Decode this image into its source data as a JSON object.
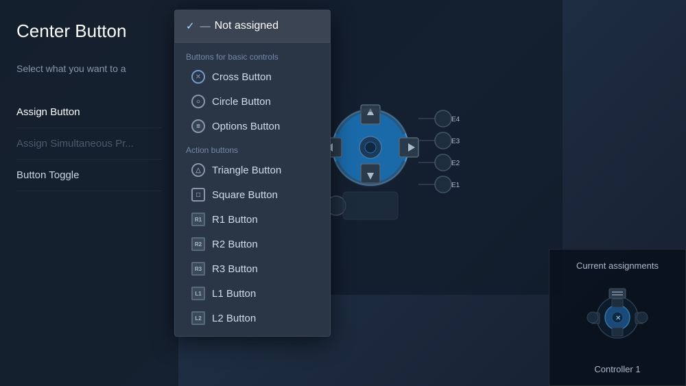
{
  "page": {
    "title": "Center Button",
    "select_hint": "Select what you want to a",
    "background_color": "#1a2535"
  },
  "menu": {
    "items": [
      {
        "label": "Assign Button",
        "state": "active"
      },
      {
        "label": "Assign Simultaneous Pr...",
        "state": "disabled"
      },
      {
        "label": "Button Toggle",
        "state": "normal"
      }
    ]
  },
  "dropdown": {
    "selected": {
      "checkmark": "✓",
      "dash": "—",
      "text": "Not assigned"
    },
    "sections": [
      {
        "label": "Buttons for basic controls",
        "items": [
          {
            "id": "cross",
            "icon_type": "cross",
            "icon_text": "✕",
            "label": "Cross Button"
          },
          {
            "id": "circle",
            "icon_type": "circle",
            "icon_text": "○",
            "label": "Circle Button"
          },
          {
            "id": "options",
            "icon_type": "options",
            "icon_text": "≡",
            "label": "Options Button"
          }
        ]
      },
      {
        "label": "Action buttons",
        "items": [
          {
            "id": "triangle",
            "icon_type": "triangle",
            "icon_text": "△",
            "label": "Triangle Button"
          },
          {
            "id": "square",
            "icon_type": "square",
            "icon_text": "□",
            "label": "Square Button"
          },
          {
            "id": "r1",
            "icon_type": "r1",
            "icon_text": "R1",
            "label": "R1 Button"
          },
          {
            "id": "r2",
            "icon_type": "r2",
            "icon_text": "R2",
            "label": "R2 Button"
          },
          {
            "id": "r3",
            "icon_type": "r3",
            "icon_text": "R3",
            "label": "R3 Button"
          },
          {
            "id": "l1",
            "icon_type": "l1",
            "icon_text": "L1",
            "label": "L1 Button"
          },
          {
            "id": "l2",
            "icon_type": "l2",
            "icon_text": "L2",
            "label": "L2 Button"
          }
        ]
      }
    ]
  },
  "assignments_panel": {
    "title": "Current assignments",
    "controller_label": "Controller 1"
  },
  "controller": {
    "e_labels": [
      "E4",
      "E3",
      "E2",
      "E1"
    ]
  }
}
